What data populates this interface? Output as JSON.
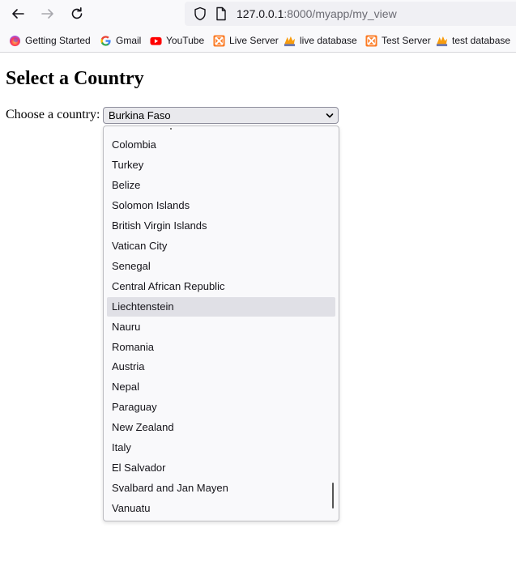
{
  "browser": {
    "url_host": "127.0.0.1",
    "url_rest": ":8000/myapp/my_view",
    "bookmarks": [
      {
        "label": "Getting Started",
        "icon": "firefox-icon"
      },
      {
        "label": "Gmail",
        "icon": "google-icon"
      },
      {
        "label": "YouTube",
        "icon": "youtube-icon"
      },
      {
        "label": "Live Server",
        "icon": "xampp-icon"
      },
      {
        "label": "live database",
        "icon": "phpmyadmin-icon"
      },
      {
        "label": "Test Server",
        "icon": "xampp-icon"
      },
      {
        "label": "test database",
        "icon": "phpmyadmin-icon"
      }
    ]
  },
  "page": {
    "title": "Select a Country",
    "label": "Choose a country:",
    "selected": "Burkina Faso"
  },
  "dropdown": {
    "hovered_option": "Liechtenstein",
    "options": [
      "Colombia",
      "Turkey",
      "Belize",
      "Solomon Islands",
      "British Virgin Islands",
      "Vatican City",
      "Senegal",
      "Central African Republic",
      "Liechtenstein",
      "Nauru",
      "Romania",
      "Austria",
      "Nepal",
      "Paraguay",
      "New Zealand",
      "Italy",
      "El Salvador",
      "Svalbard and Jan Mayen",
      "Vanuatu"
    ]
  },
  "colors": {
    "youtube": "#ff0000",
    "xampp": "#fb7a24",
    "hover": "#e0e0e6"
  }
}
